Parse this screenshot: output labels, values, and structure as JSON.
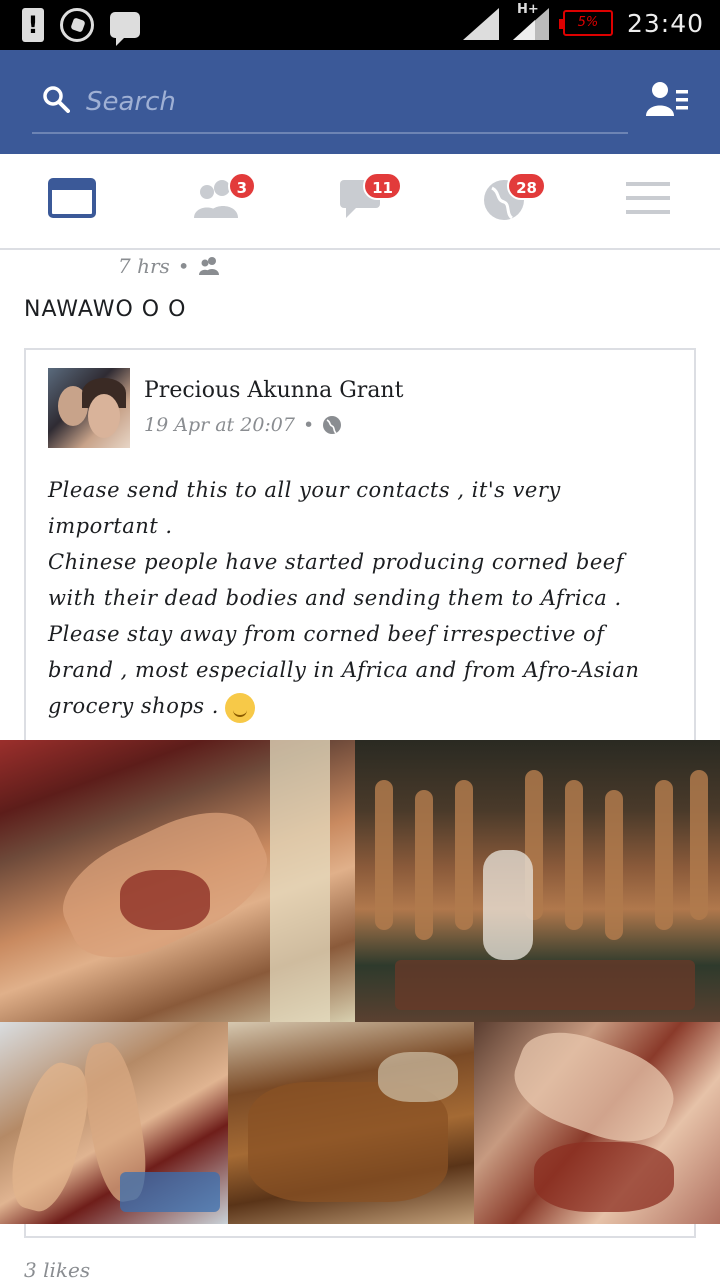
{
  "status_bar": {
    "icons": [
      "alert-icon",
      "whatsapp-icon",
      "message-icon",
      "signal-icon",
      "data-signal-icon",
      "battery-icon"
    ],
    "network": "H+",
    "battery": "5%",
    "time": "23:40",
    "battery_color": "#dd0000"
  },
  "header": {
    "search_placeholder": "Search",
    "brand_color": "#3b5998"
  },
  "nav": {
    "tabs": [
      {
        "name": "news-feed",
        "icon": "news-feed-icon",
        "badge": ""
      },
      {
        "name": "friend-requests",
        "icon": "friends-icon",
        "badge": "3"
      },
      {
        "name": "messages",
        "icon": "chat-bubble-icon",
        "badge": "11"
      },
      {
        "name": "notifications",
        "icon": "globe-icon",
        "badge": "28"
      },
      {
        "name": "menu",
        "icon": "hamburger-menu-icon",
        "badge": ""
      }
    ],
    "badge_color": "#e23b3b"
  },
  "post": {
    "time": "7 hrs",
    "audience_icon": "friends-audience-icon",
    "text": "NAWAWO O O",
    "shared": {
      "author": "Precious Akunna Grant",
      "date": "19 Apr at 20:07",
      "audience_icon": "public-globe-icon",
      "body": "Please send this to all your contacts , it's very important .\nChinese people have started producing corned beef with their dead bodies and sending them to Africa . Please stay away from corned beef irrespective of brand , most especially in Africa and from  Afro-Asian grocery shops .",
      "emoji": "smiley-emoji"
    },
    "likes": "3 likes"
  }
}
